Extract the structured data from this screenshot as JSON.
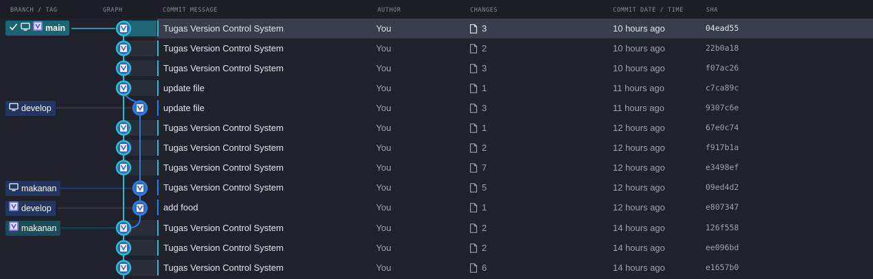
{
  "columns": {
    "branch_tag": "BRANCH / TAG",
    "graph": "GRAPH",
    "commit_message": "COMMIT MESSAGE",
    "author": "AUTHOR",
    "changes": "CHANGES",
    "commit_date": "COMMIT DATE / TIME",
    "sha": "SHA"
  },
  "colors": {
    "main_lane": "#23c1d6",
    "develop_lane": "#2e7de0",
    "node_fill": "#3a66c0",
    "selected_row": "#3a3d4a"
  },
  "tags": {
    "main": "main",
    "develop_local": "develop",
    "makanan_local": "makanan",
    "develop_remote": "develop",
    "makanan_remote": "makanan"
  },
  "commits": [
    {
      "message": "Tugas Version Control System",
      "author": "You",
      "changes": "3",
      "date": "10 hours ago",
      "sha": "04ead55"
    },
    {
      "message": "Tugas Version Control System",
      "author": "You",
      "changes": "2",
      "date": "10 hours ago",
      "sha": "22b0a18"
    },
    {
      "message": "Tugas Version Control System",
      "author": "You",
      "changes": "3",
      "date": "10 hours ago",
      "sha": "f07ac26"
    },
    {
      "message": "update file",
      "author": "You",
      "changes": "1",
      "date": "11 hours ago",
      "sha": "c7ca89c"
    },
    {
      "message": "update file",
      "author": "You",
      "changes": "3",
      "date": "11 hours ago",
      "sha": "9307c6e"
    },
    {
      "message": "Tugas Version Control System",
      "author": "You",
      "changes": "1",
      "date": "12 hours ago",
      "sha": "67e0c74"
    },
    {
      "message": "Tugas Version Control System",
      "author": "You",
      "changes": "2",
      "date": "12 hours ago",
      "sha": "f917b1a"
    },
    {
      "message": "Tugas Version Control System",
      "author": "You",
      "changes": "7",
      "date": "12 hours ago",
      "sha": "e3498ef"
    },
    {
      "message": "Tugas Version Control System",
      "author": "You",
      "changes": "5",
      "date": "12 hours ago",
      "sha": "09ed4d2"
    },
    {
      "message": "add food",
      "author": "You",
      "changes": "1",
      "date": "12 hours ago",
      "sha": "e807347"
    },
    {
      "message": "Tugas Version Control System",
      "author": "You",
      "changes": "2",
      "date": "14 hours ago",
      "sha": "126f558"
    },
    {
      "message": "Tugas Version Control System",
      "author": "You",
      "changes": "2",
      "date": "14 hours ago",
      "sha": "ee096bd"
    },
    {
      "message": "Tugas Version Control System",
      "author": "You",
      "changes": "6",
      "date": "14 hours ago",
      "sha": "e1657b0"
    }
  ]
}
